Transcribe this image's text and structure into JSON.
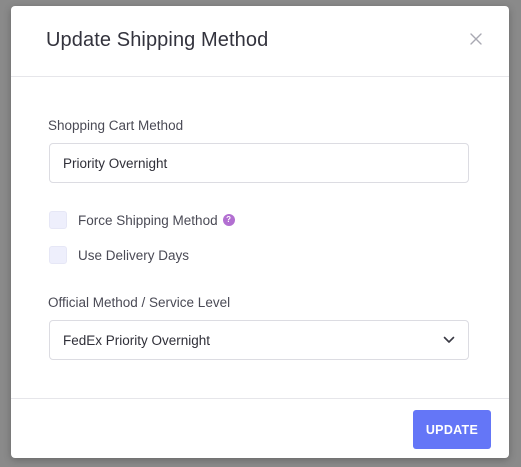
{
  "modal": {
    "title": "Update Shipping Method",
    "close_icon": "close-icon"
  },
  "form": {
    "cart_method_label": "Shopping Cart Method",
    "cart_method_value": "Priority Overnight",
    "force_shipping_label": "Force Shipping Method",
    "force_shipping_checked": false,
    "help_badge": "?",
    "delivery_days_label": "Use Delivery Days",
    "delivery_days_checked": false,
    "official_method_label": "Official Method / Service Level",
    "official_method_value": "FedEx Priority Overnight"
  },
  "footer": {
    "update_label": "UPDATE"
  },
  "colors": {
    "accent": "#6476f7",
    "help_badge": "#b26fd1",
    "checkbox_bg": "#eeeffc",
    "backdrop": "#8c8c8c"
  },
  "icons": {
    "close": "close-icon",
    "help": "help-icon",
    "dropdown": "chevron-down-icon"
  }
}
